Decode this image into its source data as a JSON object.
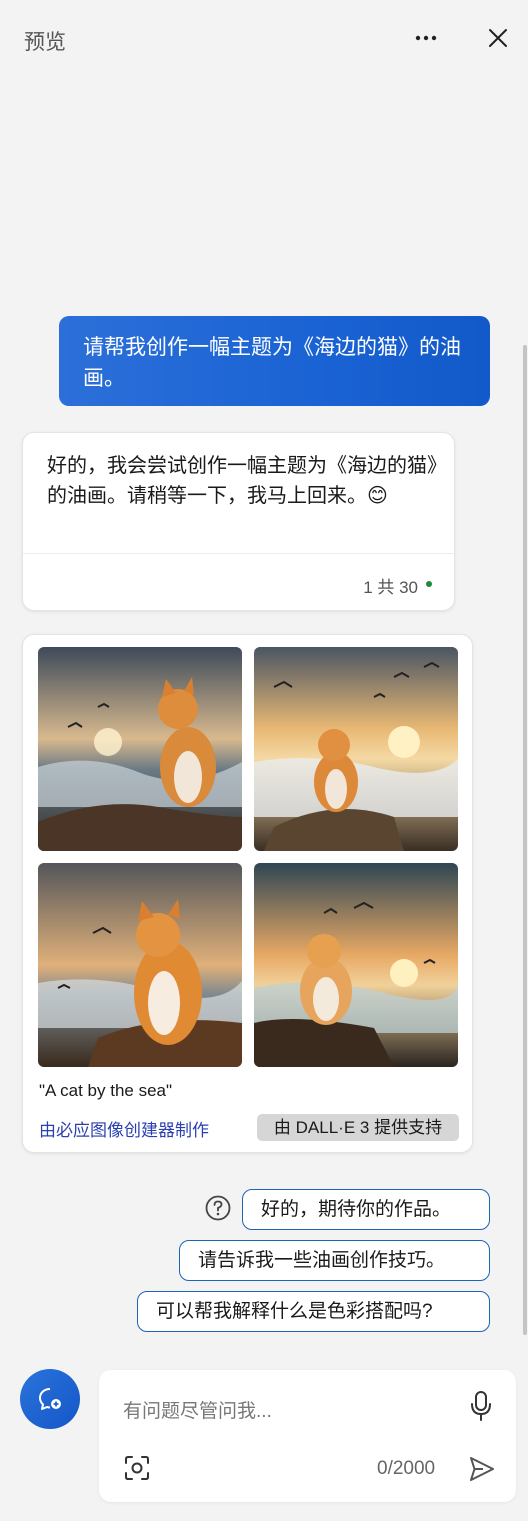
{
  "header": {
    "title": "预览",
    "more_icon": "more-horizontal-icon",
    "close_icon": "close-icon"
  },
  "conversation": {
    "user_message": "请帮我创作一幅主题为《海边的猫》的油画。",
    "bot_message": "好的，我会尝试创作一幅主题为《海边的猫》的油画。请稍等一下，我马上回来。😊",
    "turn_count": "1 共 30",
    "status_color": "#1e8a3c"
  },
  "image_card": {
    "images": [
      "cat-by-sea-image-1",
      "cat-by-sea-image-2",
      "cat-by-sea-image-3",
      "cat-by-sea-image-4"
    ],
    "caption": "\"A cat by the sea\"",
    "creator_link": "由必应图像创建器制作",
    "powered_by": "由 DALL·E 3 提供支持"
  },
  "suggestions": [
    "好的，期待你的作品。",
    "请告诉我一些油画创作技巧。",
    "可以帮我解释什么是色彩搭配吗?"
  ],
  "composer": {
    "placeholder": "有问题尽管问我...",
    "char_count": "0/2000",
    "accent": "#1a63d4"
  }
}
